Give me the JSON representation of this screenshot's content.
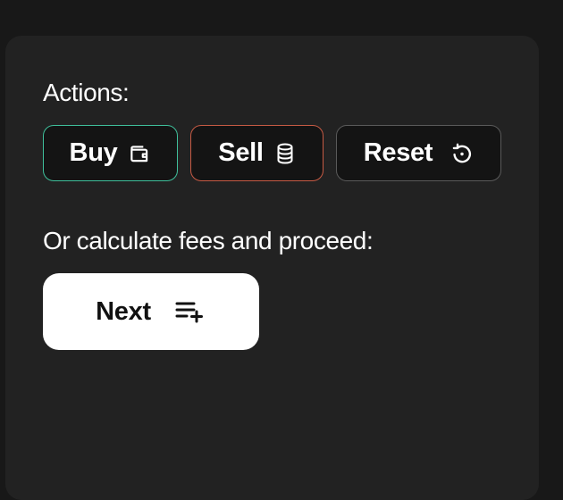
{
  "actions_section": {
    "heading": "Actions:",
    "buttons": [
      {
        "label": "Buy",
        "icon": "wallet-icon",
        "border_color": "#3fbf9b"
      },
      {
        "label": "Sell",
        "icon": "coins-icon",
        "border_color": "#c65a44"
      },
      {
        "label": "Reset",
        "icon": "reset-icon",
        "border_color": "#5a5a5a"
      }
    ]
  },
  "fees_section": {
    "heading": "Or calculate fees and proceed:",
    "next_button": {
      "label": "Next",
      "icon": "list-plus-icon"
    }
  }
}
